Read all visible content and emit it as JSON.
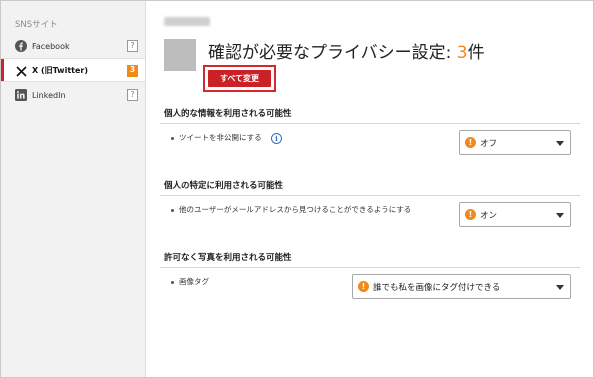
{
  "sidebar": {
    "title": "SNSサイト",
    "items": [
      {
        "label": "Facebook",
        "badge": "?",
        "icon": "facebook-icon"
      },
      {
        "label": "X (旧Twitter)",
        "badge": "3",
        "icon": "x-logo-icon"
      },
      {
        "label": "LinkedIn",
        "badge": "?",
        "icon": "linkedin-icon"
      }
    ],
    "active_index": 1
  },
  "header": {
    "title_prefix": "確認が必要なプライバシー設定: ",
    "title_count": "3",
    "title_suffix": "件",
    "change_all_label": "すべて変更"
  },
  "sections": [
    {
      "heading": "個人的な情報を利用される可能性",
      "setting_label": "ツイートを非公開にする",
      "has_info": true,
      "value": "オフ"
    },
    {
      "heading": "個人の特定に利用される可能性",
      "setting_label": "他のユーザーがメールアドレスから見つけることができるようにする",
      "has_info": false,
      "value": "オン"
    },
    {
      "heading": "許可なく写真を利用される可能性",
      "setting_label": "画像タグ",
      "has_info": false,
      "value": "誰でも私を画像にタグ付けできる"
    }
  ],
  "colors": {
    "accent_red": "#cc2027",
    "warning_orange": "#f18a1b",
    "info_blue": "#2a73c9"
  }
}
